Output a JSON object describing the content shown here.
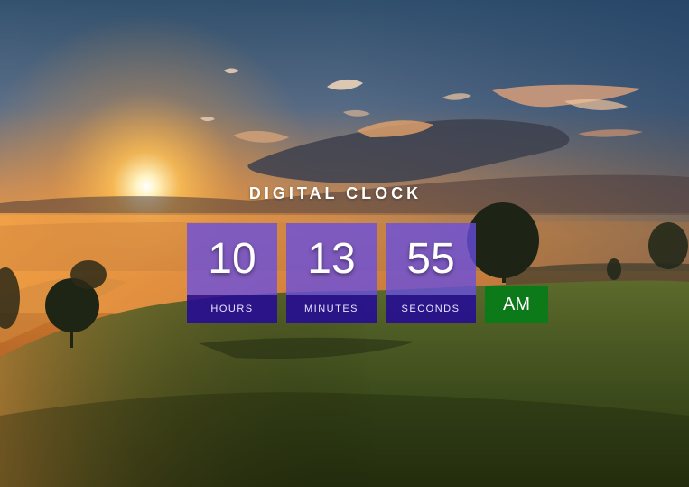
{
  "clock": {
    "title": "DIGITAL CLOCK",
    "hours": {
      "value": "10",
      "label": "HOURS"
    },
    "minutes": {
      "value": "13",
      "label": "MINUTES"
    },
    "seconds": {
      "value": "55",
      "label": "SECONDS"
    },
    "period": "AM"
  },
  "colors": {
    "digit_box": "#6a4fe2",
    "label_bar": "#240a96",
    "period_badge": "#0d7a1a"
  }
}
